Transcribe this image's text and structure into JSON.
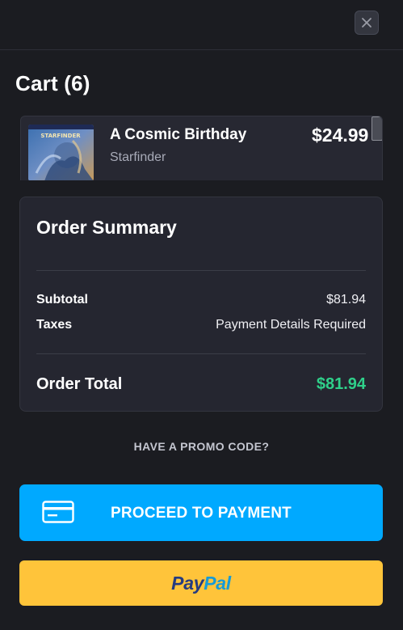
{
  "header": {
    "close_icon": "close-icon"
  },
  "cart": {
    "title": "Cart (6)",
    "items": [
      {
        "title": "A Cosmic Birthday",
        "subtitle": "Starfinder",
        "price": "$24.99",
        "thumb_label": "STARFINDER"
      }
    ]
  },
  "summary": {
    "title": "Order Summary",
    "subtotal_label": "Subtotal",
    "subtotal_value": "$81.94",
    "taxes_label": "Taxes",
    "taxes_value": "Payment Details Required",
    "total_label": "Order Total",
    "total_value": "$81.94"
  },
  "promo": {
    "label": "HAVE A PROMO CODE?"
  },
  "payment": {
    "proceed_label": "PROCEED TO PAYMENT",
    "proceed_icon": "credit-card-icon",
    "paypal_part1": "Pay",
    "paypal_part2": "Pal"
  },
  "colors": {
    "background": "#1b1c21",
    "accent_blue": "#00a9ff",
    "paypal_yellow": "#ffc43a",
    "total_green": "#2fd08a"
  }
}
